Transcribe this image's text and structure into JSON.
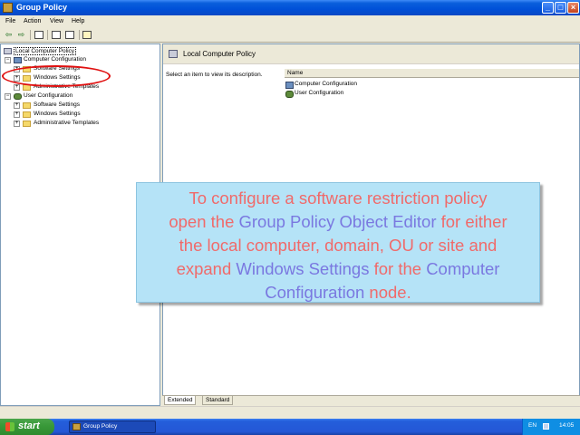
{
  "window": {
    "title": "Group Policy",
    "minimize": "_",
    "maximize": "□",
    "close": "×"
  },
  "menu": [
    "File",
    "Action",
    "View",
    "Help"
  ],
  "toolbar": {
    "back": "⇦",
    "forward": "⇨"
  },
  "tree": {
    "root": "Local Computer Policy",
    "computer_config": "Computer Configuration",
    "cc_software": "Software Settings",
    "cc_windows": "Windows Settings",
    "cc_admin": "Administrative Templates",
    "user_config": "User Configuration",
    "uc_software": "Software Settings",
    "uc_windows": "Windows Settings",
    "uc_admin": "Administrative Templates"
  },
  "right_pane": {
    "header_title": "Local Computer Policy",
    "description": "Select an item to view its description.",
    "column_name": "Name",
    "items": [
      "Computer Configuration",
      "User Configuration"
    ]
  },
  "tabs": {
    "extended": "Extended",
    "standard": "Standard"
  },
  "callout": {
    "t1": "To configure a software restriction policy",
    "t2": "open the ",
    "t3": "Group Policy Object Editor",
    "t4": " for either",
    "t5": "the local computer, domain, OU or site and",
    "t6": "expand ",
    "t7": "Windows Settings",
    "t8": " for the ",
    "t9": "Computer",
    "t10": "Configuration",
    "t11": " node.",
    "text_color": "#f06a6a",
    "highlight_color": "#7a78e0",
    "background": "#b5e3f7"
  },
  "annotation": {
    "circle_color": "#e01010"
  },
  "taskbar": {
    "start_label": "start",
    "task_label": "Group Policy",
    "language": "EN",
    "clock": "14:05"
  }
}
